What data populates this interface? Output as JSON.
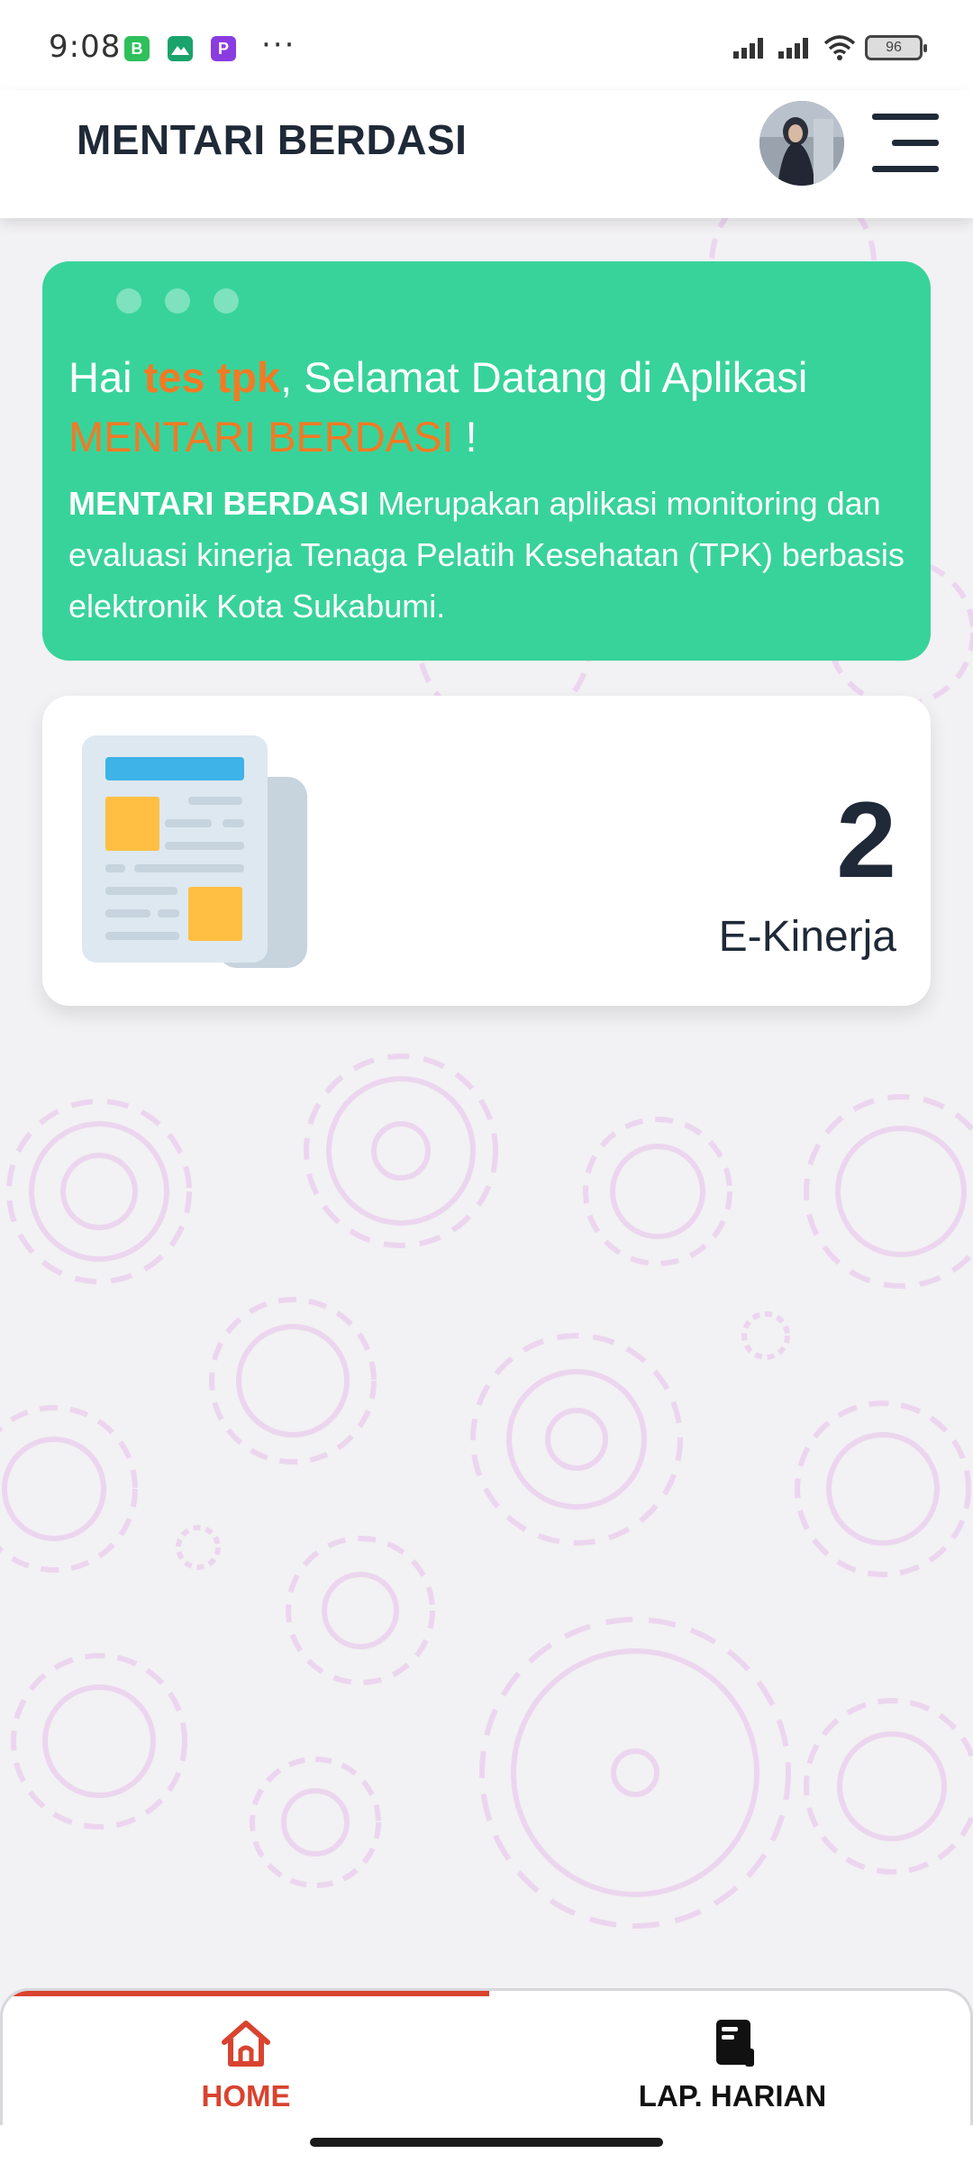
{
  "status_bar": {
    "time": "9:08",
    "notification_icons": [
      "B",
      "",
      "P"
    ],
    "overflow": "···",
    "battery": "96"
  },
  "header": {
    "title": "MENTARI BERDASI"
  },
  "welcome": {
    "greeting_prefix": "Hai ",
    "user_name": "tes tpk",
    "greeting_suffix": ", Selamat Datang di Aplikasi",
    "app_name": "MENTARI BERDASI",
    "exclaim": " !",
    "desc_bold": "MENTARI BERDASI",
    "desc_text": " Merupakan aplikasi monitoring dan evaluasi kinerja Tenaga Pelatih Kesehatan (TPK) berbasis elektronik Kota Sukabumi."
  },
  "stat_card": {
    "value": "2",
    "label": "E-Kinerja",
    "icon": "newspaper-icon"
  },
  "bottom_nav": {
    "items": [
      {
        "label": "HOME",
        "icon": "home-icon",
        "active": true
      },
      {
        "label": "LAP. HARIAN",
        "icon": "book-icon",
        "active": false
      }
    ]
  },
  "colors": {
    "accent_green": "#38d39a",
    "accent_orange": "#f27a24",
    "active_red": "#d9432f",
    "text_dark": "#1f2937"
  }
}
